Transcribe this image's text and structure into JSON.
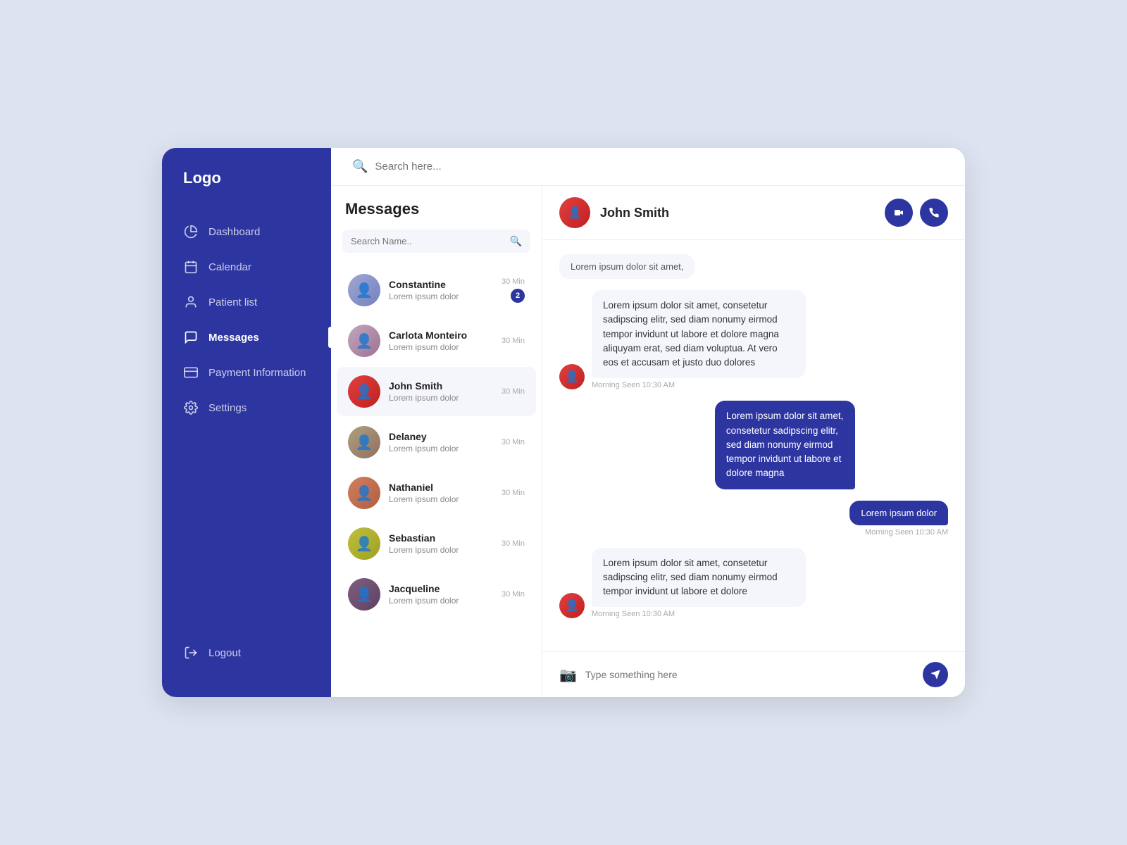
{
  "sidebar": {
    "logo": "Logo",
    "items": [
      {
        "id": "dashboard",
        "label": "Dashboard",
        "icon": "pie-chart"
      },
      {
        "id": "calendar",
        "label": "Calendar",
        "icon": "calendar"
      },
      {
        "id": "patient-list",
        "label": "Patient list",
        "icon": "user"
      },
      {
        "id": "messages",
        "label": "Messages",
        "icon": "chat",
        "active": true
      },
      {
        "id": "payment",
        "label": "Payment Information",
        "icon": "card"
      },
      {
        "id": "settings",
        "label": "Settings",
        "icon": "gear"
      }
    ],
    "logout_label": "Logout"
  },
  "header": {
    "search_placeholder": "Search here..."
  },
  "messages_panel": {
    "title": "Messages",
    "search_placeholder": "Search Name..",
    "contacts": [
      {
        "id": 1,
        "name": "Constantine",
        "preview": "Lorem ipsum dolor",
        "time": "30 Min",
        "badge": 2,
        "av": "av-1"
      },
      {
        "id": 2,
        "name": "Carlota Monteiro",
        "preview": "Lorem ipsum dolor",
        "time": "30 Min",
        "badge": null,
        "av": "av-2"
      },
      {
        "id": 3,
        "name": "John Smith",
        "preview": "Lorem ipsum dolor",
        "time": "30 Min",
        "badge": null,
        "av": "av-chat",
        "active": true
      },
      {
        "id": 4,
        "name": "Delaney",
        "preview": "Lorem ipsum dolor",
        "time": "30 Min",
        "badge": null,
        "av": "av-4"
      },
      {
        "id": 5,
        "name": "Nathaniel",
        "preview": "Lorem ipsum dolor",
        "time": "30 Min",
        "badge": null,
        "av": "av-5"
      },
      {
        "id": 6,
        "name": "Sebastian",
        "preview": "Lorem ipsum dolor",
        "time": "30 Min",
        "badge": null,
        "av": "av-6"
      },
      {
        "id": 7,
        "name": "Jacqueline",
        "preview": "Lorem ipsum dolor",
        "time": "30 Min",
        "badge": null,
        "av": "av-7"
      }
    ]
  },
  "chat": {
    "contact_name": "John Smith",
    "messages": [
      {
        "id": 1,
        "type": "received-small",
        "text": "Lorem ipsum dolor sit amet,",
        "time": null
      },
      {
        "id": 2,
        "type": "received",
        "text": "Lorem ipsum dolor sit amet, consetetur sadipscing elitr, sed diam nonumy eirmod tempor invidunt ut labore et dolore magna aliquyam erat, sed diam voluptua. At vero eos et accusam et justo duo dolores",
        "time": "Morning Seen 10:30 AM"
      },
      {
        "id": 3,
        "type": "sent",
        "text": "Lorem ipsum dolor sit amet, consetetur sadipscing elitr, sed diam nonumy eirmod tempor invidunt ut labore et dolore magna",
        "time": null
      },
      {
        "id": 4,
        "type": "sent-small",
        "text": "Lorem ipsum dolor",
        "time": "Morning Seen 10:30 AM"
      },
      {
        "id": 5,
        "type": "received",
        "text": "Lorem ipsum dolor sit amet, consetetur sadipscing elitr, sed diam nonumy eirmod tempor invidunt ut labore et dolore",
        "time": "Morning Seen 10:30 AM"
      }
    ],
    "input_placeholder": "Type something here"
  }
}
